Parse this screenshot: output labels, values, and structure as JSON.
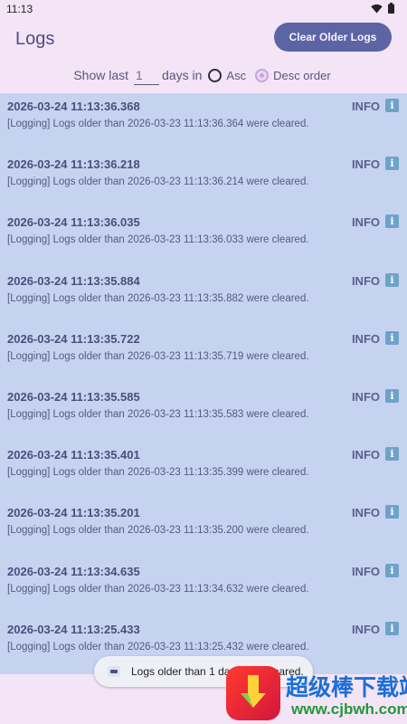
{
  "status_bar": {
    "time": "11:13",
    "icons": [
      "wifi-icon",
      "battery-icon"
    ]
  },
  "header": {
    "title": "Logs",
    "clear_button_label": "Clear Older Logs"
  },
  "filter": {
    "prefix": "Show last",
    "days_value": "",
    "days_placeholder": "1",
    "suffix": "days in",
    "asc_label": "Asc",
    "desc_label": "Desc order",
    "selected_order": "desc"
  },
  "logs": [
    {
      "timestamp": "2026-03-24 11:13:36.368",
      "level": "INFO",
      "message": "[Logging] Logs older than 2026-03-23 11:13:36.364 were cleared."
    },
    {
      "timestamp": "2026-03-24 11:13:36.218",
      "level": "INFO",
      "message": "[Logging] Logs older than 2026-03-23 11:13:36.214 were cleared."
    },
    {
      "timestamp": "2026-03-24 11:13:36.035",
      "level": "INFO",
      "message": "[Logging] Logs older than 2026-03-23 11:13:36.033 were cleared."
    },
    {
      "timestamp": "2026-03-24 11:13:35.884",
      "level": "INFO",
      "message": "[Logging] Logs older than 2026-03-23 11:13:35.882 were cleared."
    },
    {
      "timestamp": "2026-03-24 11:13:35.722",
      "level": "INFO",
      "message": "[Logging] Logs older than 2026-03-23 11:13:35.719 were cleared."
    },
    {
      "timestamp": "2026-03-24 11:13:35.585",
      "level": "INFO",
      "message": "[Logging] Logs older than 2026-03-23 11:13:35.583 were cleared."
    },
    {
      "timestamp": "2026-03-24 11:13:35.401",
      "level": "INFO",
      "message": "[Logging] Logs older than 2026-03-23 11:13:35.399 were cleared."
    },
    {
      "timestamp": "2026-03-24 11:13:35.201",
      "level": "INFO",
      "message": "[Logging] Logs older than 2026-03-23 11:13:35.200 were cleared."
    },
    {
      "timestamp": "2026-03-24 11:13:34.635",
      "level": "INFO",
      "message": "[Logging] Logs older than 2026-03-23 11:13:34.632 were cleared."
    },
    {
      "timestamp": "2026-03-24 11:13:25.433",
      "level": "INFO",
      "message": "[Logging] Logs older than 2026-03-23 11:13:25.432 were cleared."
    }
  ],
  "toast": {
    "text": "Logs older than 1 day were cleared."
  },
  "watermark": {
    "title": "超级棒下载站",
    "url": "www.cjbwh.com"
  },
  "colors": {
    "accent": "#5c64a4",
    "list_bg": "#c5d3f1",
    "page_bg": "#f3e4f6",
    "info_icon": "#6ea3c9"
  }
}
